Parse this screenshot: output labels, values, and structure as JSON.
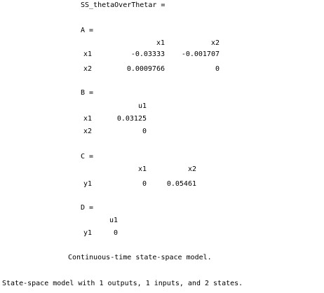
{
  "variable_name": "SS_thetaOverThetar =",
  "matrices": {
    "A": {
      "header": "A =",
      "columns": [
        "x1",
        "x2"
      ],
      "rows": [
        {
          "label": "x1",
          "values": [
            "-0.03333",
            "-0.001707"
          ]
        },
        {
          "label": "x2",
          "values": [
            "0.0009766",
            "0"
          ]
        }
      ]
    },
    "B": {
      "header": "B =",
      "columns": [
        "u1"
      ],
      "rows": [
        {
          "label": "x1",
          "values": [
            "0.03125"
          ]
        },
        {
          "label": "x2",
          "values": [
            "0"
          ]
        }
      ]
    },
    "C": {
      "header": "C =",
      "columns": [
        "x1",
        "x2"
      ],
      "rows": [
        {
          "label": "y1",
          "values": [
            "0",
            "0.05461"
          ]
        }
      ]
    },
    "D": {
      "header": "D =",
      "columns": [
        "u1"
      ],
      "rows": [
        {
          "label": "y1",
          "values": [
            "0"
          ]
        }
      ]
    }
  },
  "model_type": "Continuous-time state-space model.",
  "summary": "State-space model with 1 outputs, 1 inputs, and 2 states."
}
